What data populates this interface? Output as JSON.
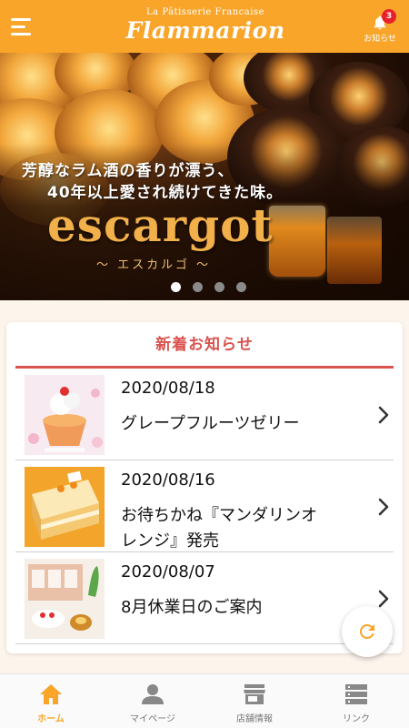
{
  "header": {
    "logo_top": "La Pâtisserie Francaise",
    "logo_main": "Flammarion",
    "notice_label": "お知らせ",
    "notice_badge": "3"
  },
  "banner": {
    "copy_line1": "芳醇なラム酒の香りが漂う、",
    "copy_line2": "40年以上愛され続けてきた味。",
    "title": "escargot",
    "subtitle": "～ エスカルゴ ～",
    "slides_count": 4,
    "active_slide": 1
  },
  "news": {
    "title": "新着お知らせ",
    "items": [
      {
        "date": "2020/08/18",
        "title": "グレープフルーツゼリー"
      },
      {
        "date": "2020/08/16",
        "title": "お待ちかね『マンダリンオレンジ』発売"
      },
      {
        "date": "2020/08/07",
        "title": "8月休業日のご案内"
      }
    ]
  },
  "nav": {
    "items": [
      {
        "label": "ホーム",
        "icon": "home-icon",
        "active": true
      },
      {
        "label": "マイページ",
        "icon": "user-icon",
        "active": false
      },
      {
        "label": "店舗情報",
        "icon": "store-icon",
        "active": false
      },
      {
        "label": "リンク",
        "icon": "list-icon",
        "active": false
      }
    ]
  },
  "colors": {
    "accent": "#f8a52a",
    "news_title": "#d9534f",
    "badge": "#e8202a"
  }
}
